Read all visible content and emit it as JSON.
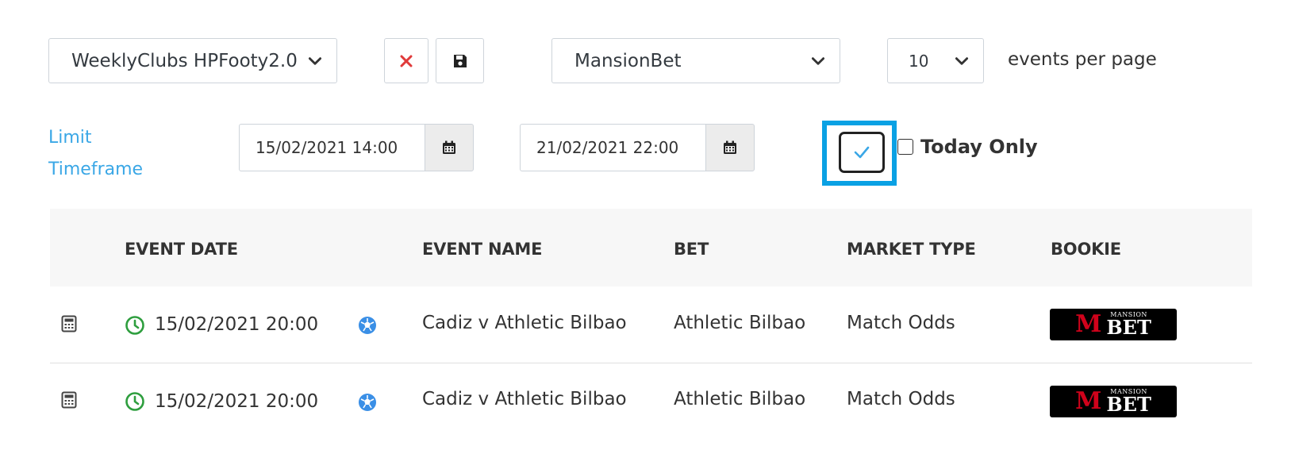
{
  "filters": {
    "saved_filter": "WeeklyClubs HPFooty2.0",
    "bookie": "MansionBet",
    "per_page": "10",
    "per_page_label": "events per page"
  },
  "icons": {
    "delete": "close-icon",
    "save": "save-icon",
    "calendar": "calendar-icon",
    "chevron": "chevron-down-icon",
    "check": "checkmark-icon",
    "clock": "clock-icon",
    "sport": "soccer-ball-icon",
    "row_menu": "calculator-icon"
  },
  "timeframe": {
    "label": "Limit Timeframe",
    "start": "15/02/2021 14:00",
    "end": "21/02/2021 22:00",
    "today_only_label": "Today Only"
  },
  "table": {
    "headers": {
      "event_date": "EVENT DATE",
      "event_name": "EVENT NAME",
      "bet": "BET",
      "market_type": "MARKET TYPE",
      "bookie": "BOOKIE"
    },
    "rows": [
      {
        "event_date": "15/02/2021 20:00",
        "event_name": "Cadiz v Athletic Bilbao",
        "bet": "Athletic Bilbao",
        "market_type": "Match Odds",
        "bookie_logo_top": "MANSION",
        "bookie_logo_bottom": "BET"
      },
      {
        "event_date": "15/02/2021 20:00",
        "event_name": "Cadiz v Athletic Bilbao",
        "bet": "Athletic Bilbao",
        "market_type": "Match Odds",
        "bookie_logo_top": "MANSION",
        "bookie_logo_bottom": "BET"
      }
    ]
  },
  "colors": {
    "accent": "#3aa7e6",
    "highlight": "#0aa1e4",
    "delete_red": "#e03a3a",
    "clock_green": "#2e9e3e",
    "logo_red": "#d0021b"
  }
}
